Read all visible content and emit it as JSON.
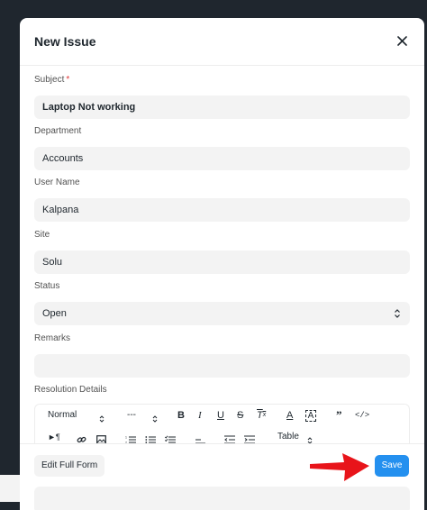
{
  "modal": {
    "title": "New Issue"
  },
  "fields": {
    "subject": {
      "label": "Subject",
      "required_mark": "*",
      "value": "Laptop Not working"
    },
    "department": {
      "label": "Department",
      "value": "Accounts"
    },
    "user_name": {
      "label": "User Name",
      "value": "Kalpana"
    },
    "site": {
      "label": "Site",
      "value": "Solu"
    },
    "status": {
      "label": "Status",
      "value": "Open"
    },
    "remarks": {
      "label": "Remarks",
      "value": ""
    },
    "resolution_details": {
      "label": "Resolution Details"
    }
  },
  "editor_toolbar": {
    "paragraph_style": "Normal",
    "font_size": "---",
    "table_label": "Table",
    "icons": [
      "bold-icon",
      "italic-icon",
      "underline-icon",
      "strikethrough-icon",
      "clear-format-icon",
      "text-color-icon",
      "background-color-icon",
      "blockquote-icon",
      "code-block-icon",
      "text-direction-icon",
      "link-icon",
      "image-icon",
      "ordered-list-icon",
      "bullet-list-icon",
      "check-list-icon",
      "align-icon",
      "outdent-icon",
      "indent-icon"
    ]
  },
  "footer": {
    "edit_full_form_label": "Edit Full Form",
    "save_label": "Save"
  },
  "colors": {
    "primary": "#2490ef",
    "annotation_arrow": "#e8141a",
    "backdrop": "#1f262e"
  }
}
